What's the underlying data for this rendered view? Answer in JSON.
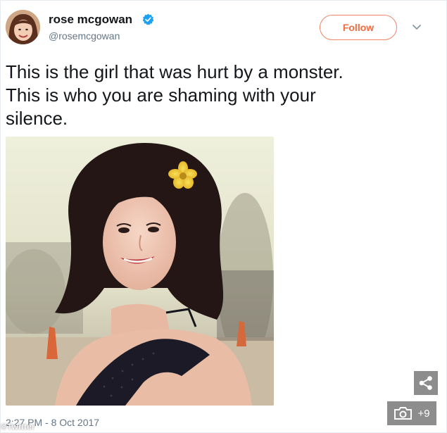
{
  "tweet": {
    "display_name": "rose mcgowan",
    "handle": "@rosemcgowan",
    "follow_label": "Follow",
    "text_lines": [
      "This is the girl that was hurt by a monster.",
      "This is who you are shaming with your",
      "silence."
    ],
    "timestamp": "2:27 PM - 8 Oct 2017"
  },
  "overlay": {
    "watermark": "©Twitter",
    "gallery_count": "+9"
  },
  "colors": {
    "follow_accent": "#f26a3e",
    "verified_blue": "#1da1f2",
    "overlay_button": "#8d8d8d"
  },
  "icons": [
    "verified-badge-icon",
    "chevron-down-icon",
    "share-icon",
    "camera-icon"
  ]
}
